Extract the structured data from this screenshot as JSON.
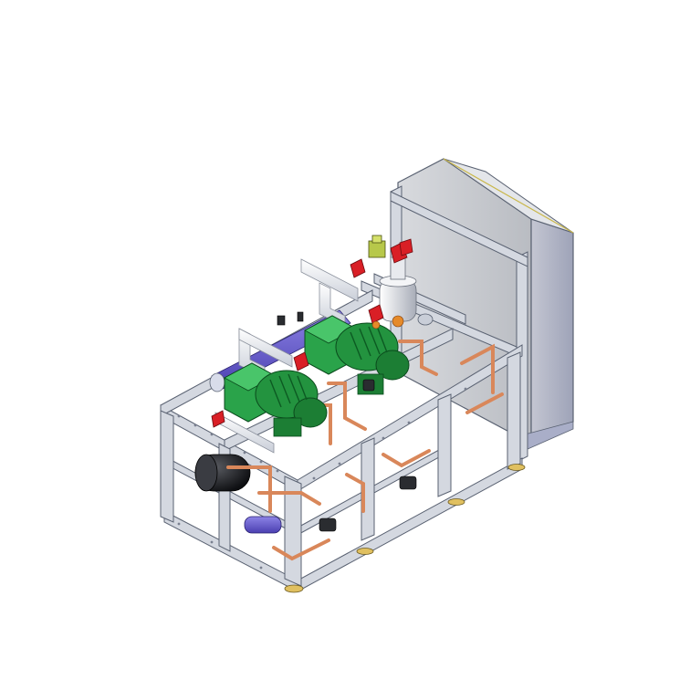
{
  "image": {
    "subject": "skid-mounted-refrigeration-compressor-rack",
    "background_color": "#ffffff"
  },
  "colors": {
    "frame": "#d4d8e0",
    "frame_edge": "#5a6272",
    "panel": "#c9cbcf",
    "panel_side": "#b8bac4",
    "compressor": "#2aa34a",
    "compressor_dark": "#137a30",
    "copper_pipe": "#d9875a",
    "suction_header": "#6b5fd0",
    "valve": "#d91f26",
    "receiver_tank": "#222428",
    "feet": "#e0c060",
    "white_pipe": "#f0f2f5"
  }
}
